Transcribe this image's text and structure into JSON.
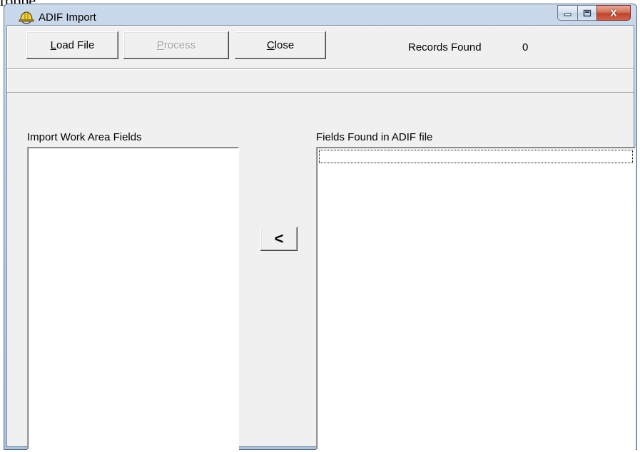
{
  "window": {
    "title": "ADIF Import",
    "background_fragment": "roppe",
    "icon": "hard-hat-icon",
    "controls": {
      "minimize_icon": "minimize-icon",
      "maximize_icon": "maximize-icon",
      "close_icon": "close-x-icon",
      "close_glyph": "X"
    }
  },
  "toolbar": {
    "load_file": {
      "accel": "L",
      "rest": "oad File"
    },
    "process": {
      "accel": "P",
      "rest": "rocess",
      "enabled": false
    },
    "close": {
      "accel": "C",
      "rest": "lose"
    },
    "records_found_label": "Records Found",
    "records_found_count": "0"
  },
  "panels": {
    "left": {
      "label": "Import Work Area Fields",
      "items": []
    },
    "right": {
      "label": "Fields Found in ADIF file",
      "items": []
    },
    "move_button_label": "<"
  },
  "colors": {
    "face": "#f0f0f0",
    "title_bar": "#b8cce3",
    "close_button": "#c0432a",
    "disabled_text": "#a0a0a0"
  }
}
